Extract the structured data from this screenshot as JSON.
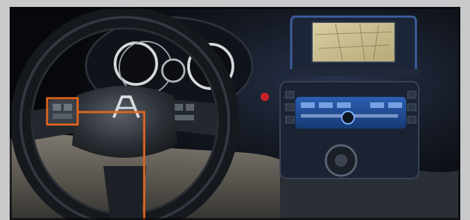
{
  "image": {
    "subject": "car-dashboard-photo",
    "callout_color": "#e2671f",
    "frame_color": "#c8c9cb",
    "screen_color": "#c7b98a",
    "accent_blue": "#3f7fd8"
  },
  "labels": {
    "steering_logo_text": ""
  }
}
